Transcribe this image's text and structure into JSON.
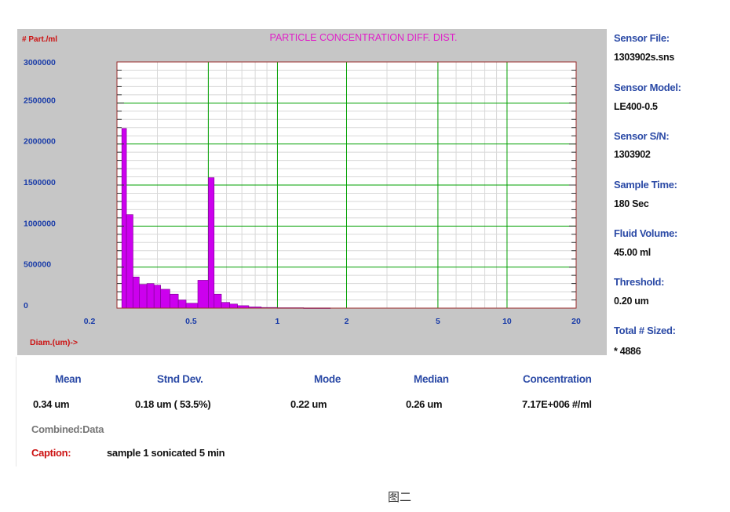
{
  "chart_data": {
    "type": "bar",
    "title": "PARTICLE CONCENTRATION DIFF. DIST.",
    "ylabel": "# Part./ml",
    "xlabel": "Diam.(um)->",
    "xscale": "log",
    "xlim": [
      0.2,
      20
    ],
    "ylim": [
      0,
      3000000
    ],
    "y_ticks": [
      3000000,
      2500000,
      2000000,
      1500000,
      1000000,
      500000,
      0
    ],
    "x_ticks": [
      0.2,
      0.5,
      1,
      2,
      5,
      10,
      20
    ],
    "bars": [
      {
        "x": 0.21,
        "x_end": 0.22,
        "value": 2190000
      },
      {
        "x": 0.22,
        "x_end": 0.235,
        "value": 1140000
      },
      {
        "x": 0.235,
        "x_end": 0.25,
        "value": 380000
      },
      {
        "x": 0.25,
        "x_end": 0.27,
        "value": 290000
      },
      {
        "x": 0.27,
        "x_end": 0.29,
        "value": 300000
      },
      {
        "x": 0.29,
        "x_end": 0.31,
        "value": 280000
      },
      {
        "x": 0.31,
        "x_end": 0.34,
        "value": 230000
      },
      {
        "x": 0.34,
        "x_end": 0.37,
        "value": 170000
      },
      {
        "x": 0.37,
        "x_end": 0.4,
        "value": 100000
      },
      {
        "x": 0.4,
        "x_end": 0.45,
        "value": 60000
      },
      {
        "x": 0.45,
        "x_end": 0.5,
        "value": 340000
      },
      {
        "x": 0.5,
        "x_end": 0.53,
        "value": 1590000
      },
      {
        "x": 0.53,
        "x_end": 0.57,
        "value": 170000
      },
      {
        "x": 0.57,
        "x_end": 0.62,
        "value": 70000
      },
      {
        "x": 0.62,
        "x_end": 0.67,
        "value": 50000
      },
      {
        "x": 0.67,
        "x_end": 0.75,
        "value": 30000
      },
      {
        "x": 0.75,
        "x_end": 0.85,
        "value": 15000
      },
      {
        "x": 0.85,
        "x_end": 1.0,
        "value": 8000
      },
      {
        "x": 1.0,
        "x_end": 1.3,
        "value": 5000
      },
      {
        "x": 1.3,
        "x_end": 1.7,
        "value": 3000
      }
    ],
    "colors": {
      "bar": "#cc00ee",
      "bar_edge": "#7a0090",
      "title": "#e020c8",
      "axis_label": "#cc1111",
      "major_grid": "#00a000",
      "minor_grid": "#d8d8d8",
      "frame": "#9a2a2a",
      "tick_label": "#1a3ca8"
    }
  },
  "sidebar": {
    "sensor_file_label": "Sensor File:",
    "sensor_file_value": "1303902s.sns",
    "sensor_model_label": "Sensor Model:",
    "sensor_model_value": "LE400-0.5",
    "sensor_sn_label": "Sensor S/N:",
    "sensor_sn_value": "1303902",
    "sample_time_label": "Sample Time:",
    "sample_time_value": "180 Sec",
    "fluid_volume_label": "Fluid Volume:",
    "fluid_volume_value": "45.00 ml",
    "threshold_label": "Threshold:",
    "threshold_value": "0.20 um",
    "total_sized_label": "Total # Sized:",
    "total_sized_value": "* 4886"
  },
  "stats": {
    "mean_label": "Mean",
    "mean_value": "0.34 um",
    "std_label": "Stnd Dev.",
    "std_value": "0.18 um ( 53.5%)",
    "mode_label": "Mode",
    "mode_value": "0.22 um",
    "median_label": "Median",
    "median_value": "0.26 um",
    "concentration_label": "Concentration",
    "concentration_value": "7.17E+006 #/ml"
  },
  "footer": {
    "combined": "Combined:Data",
    "caption_label": "Caption:",
    "caption_text": "sample 1 sonicated 5 min",
    "figure_caption": "图二"
  }
}
